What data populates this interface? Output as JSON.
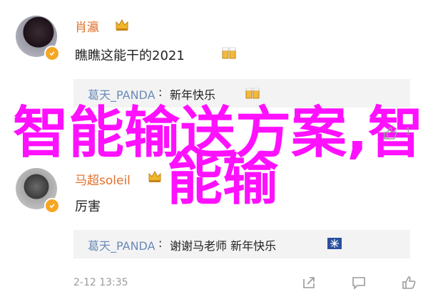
{
  "comments": [
    {
      "username": "肖瀛",
      "text": "瞧瞧这能干的2021",
      "reply": {
        "username": "葛天_PANDA",
        "separator": ":",
        "text": "新年快乐"
      }
    },
    {
      "username": "马超soleil",
      "text": "厉害",
      "reply": {
        "username": "葛天_PANDA",
        "separator": ":",
        "text": "谢谢马老师 新年快乐"
      },
      "timestamp": "2-12 13:35"
    }
  ],
  "overlay": {
    "line1": "智能输送方案,智",
    "line2": "能输"
  },
  "counts": {
    "like": "1"
  },
  "colors": {
    "username": "#e0702a",
    "reply_username": "#6a8ab8",
    "overlay": "#ff10ff",
    "verified_badge": "#f5a623"
  },
  "icons": [
    "verified-icon",
    "crown-icon",
    "beer-emoji-icon",
    "thumbs-up-icon",
    "share-icon",
    "comment-icon"
  ]
}
